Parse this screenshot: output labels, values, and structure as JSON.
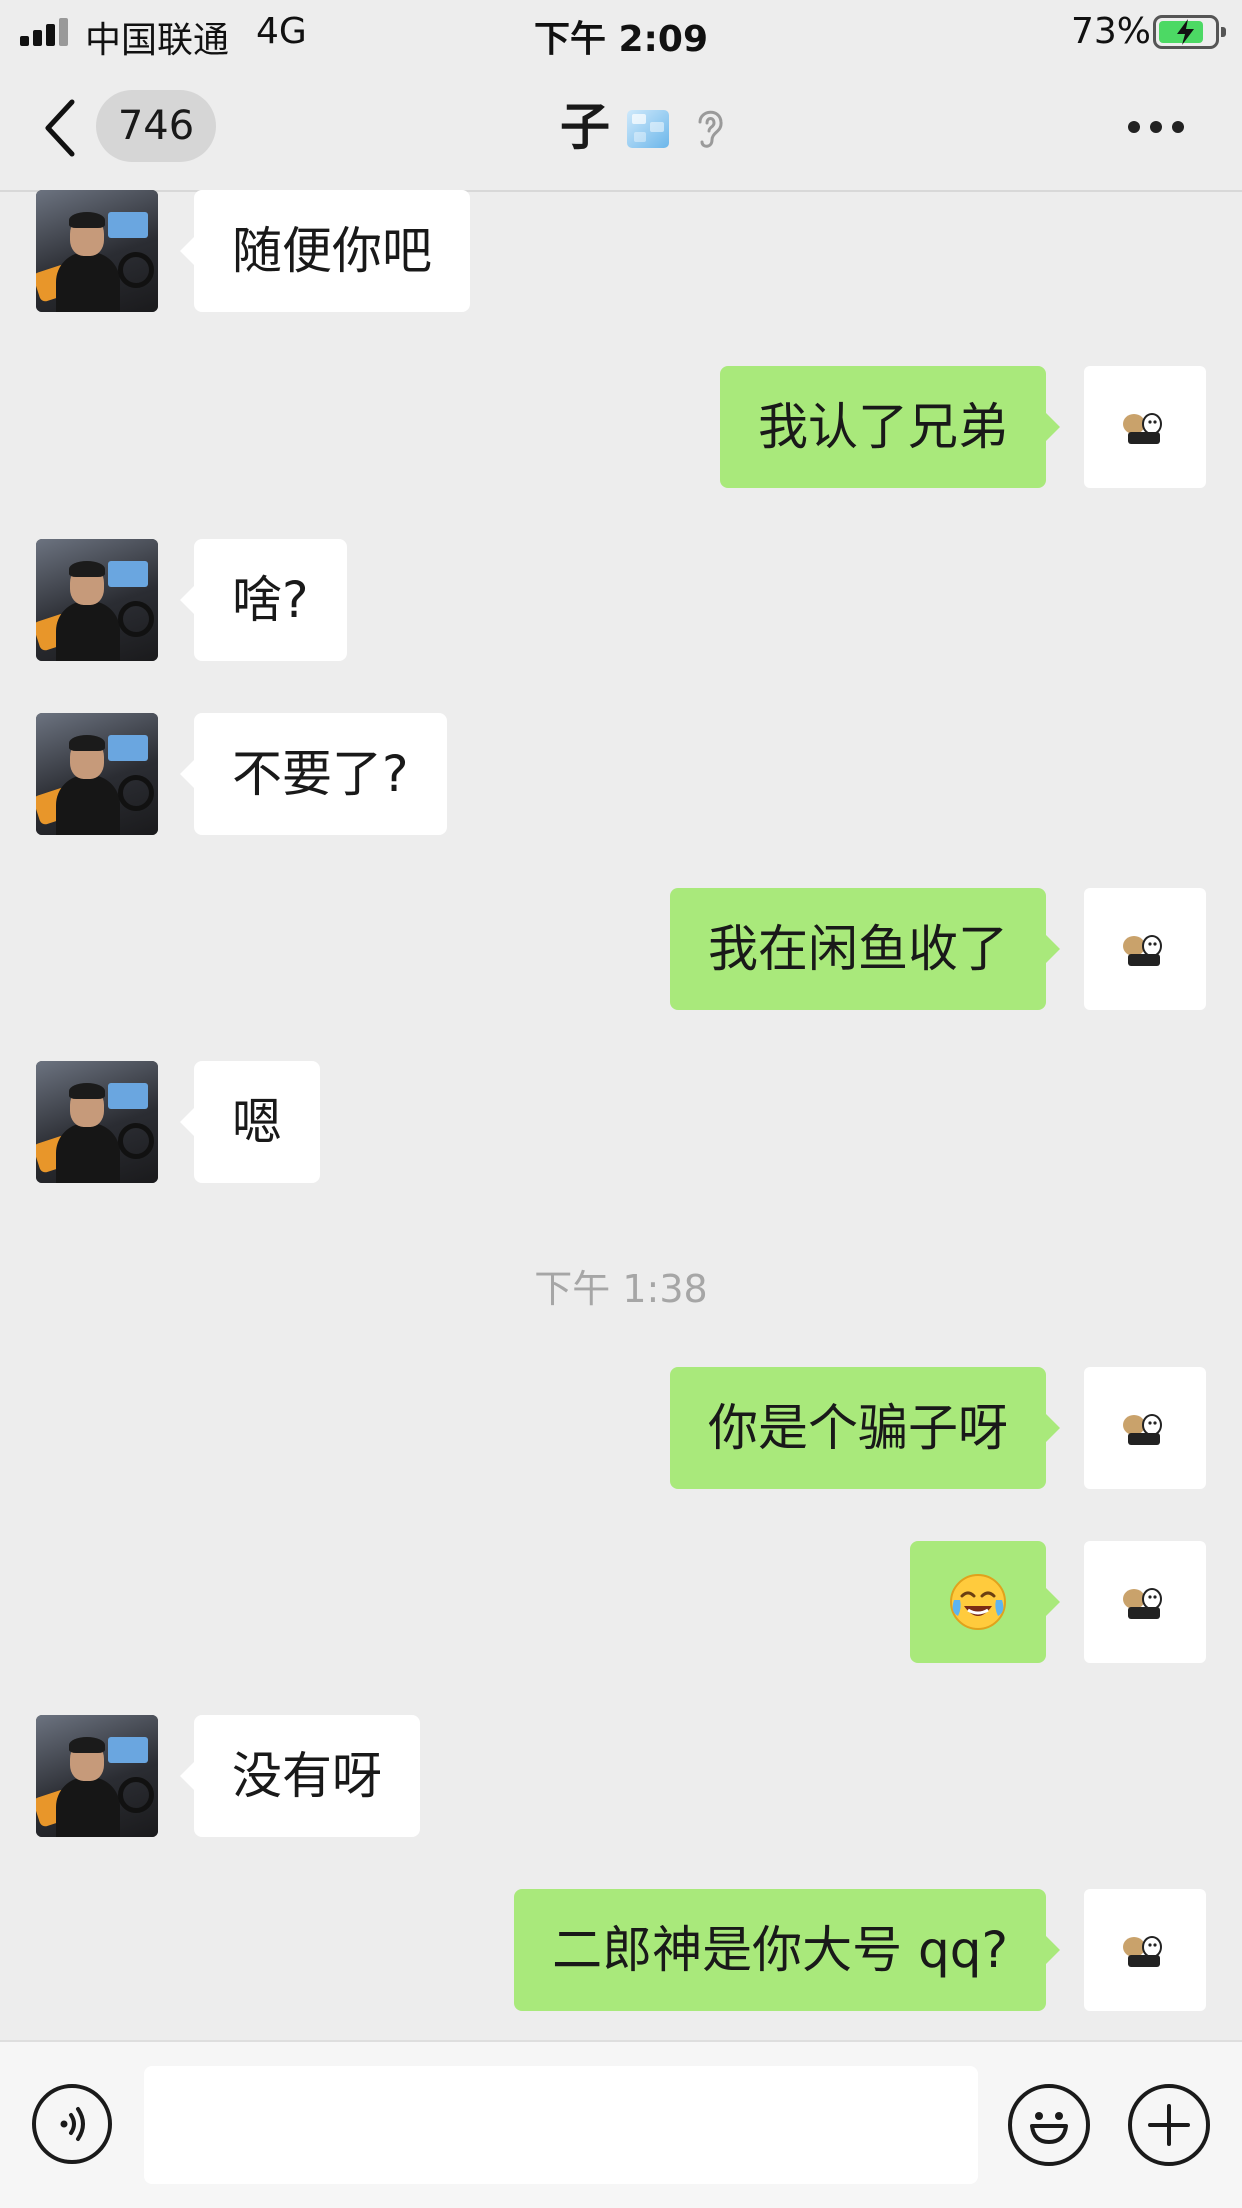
{
  "status_bar": {
    "carrier": "中国联通",
    "network": "4G",
    "time": "下午 2:09",
    "battery_percent": "73%",
    "battery_level": 0.73
  },
  "nav": {
    "unread_count": "746",
    "title": "子",
    "title_icons": [
      "ice-cube-icon",
      "ear-icon"
    ]
  },
  "messages": [
    {
      "side": "left",
      "text": "随便你吧"
    },
    {
      "side": "right",
      "text": "我认了兄弟"
    },
    {
      "side": "left",
      "text": "啥?"
    },
    {
      "side": "left",
      "text": "不要了?"
    },
    {
      "side": "right",
      "text": "我在闲鱼收了"
    },
    {
      "side": "left",
      "text": "嗯"
    },
    {
      "side": "right",
      "text": "你是个骗子呀"
    },
    {
      "side": "right",
      "text": "",
      "emoji": "laughing-crying-face-icon"
    },
    {
      "side": "left",
      "text": "没有呀"
    },
    {
      "side": "right",
      "text": "二郎神是你大号 qq?"
    }
  ],
  "timestamp": "下午 1:38",
  "input_bar": {
    "icons": [
      "voice-icon",
      "emoji-icon",
      "plus-icon"
    ],
    "value": ""
  },
  "colors": {
    "background": "#ededed",
    "sent_bubble": "#a9e97b",
    "received_bubble": "#ffffff",
    "battery": "#4cd964"
  }
}
